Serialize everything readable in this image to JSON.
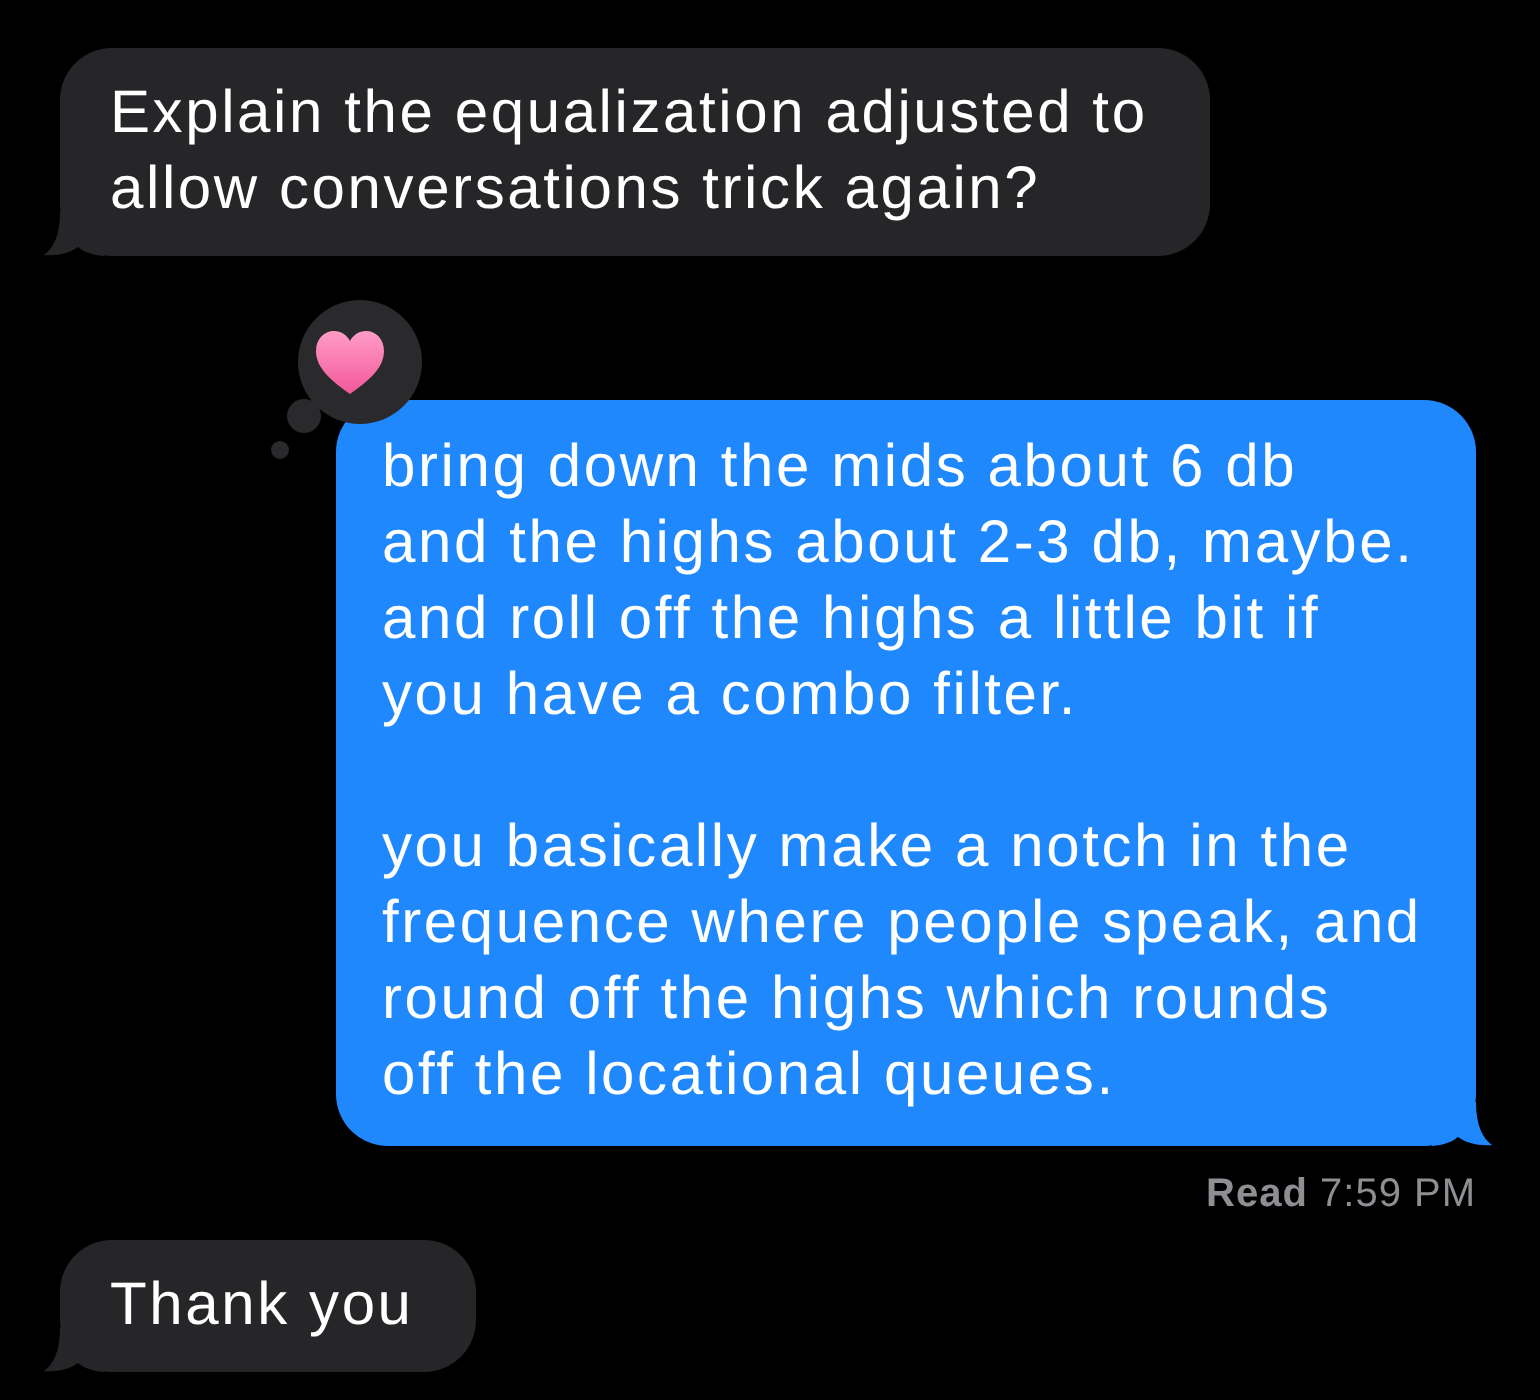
{
  "messages": [
    {
      "outgoing": false,
      "paragraphs": [
        "Explain the equalization adjusted to\nallow conversations trick again?"
      ]
    },
    {
      "outgoing": true,
      "tapback": {
        "kind": "heart"
      },
      "paragraphs": [
        "bring down the mids about 6 db\nand the highs about 2-3 db, maybe.\nand roll off the highs a little bit if\nyou have a combo filter.",
        "you basically make a notch in the\nfrequence where people speak, and\nround off the highs which rounds\noff the locational queues."
      ],
      "receipt": "**Read** 7:59 PM"
    },
    {
      "outgoing": false,
      "paragraphs": [
        "Thank you"
      ]
    }
  ]
}
